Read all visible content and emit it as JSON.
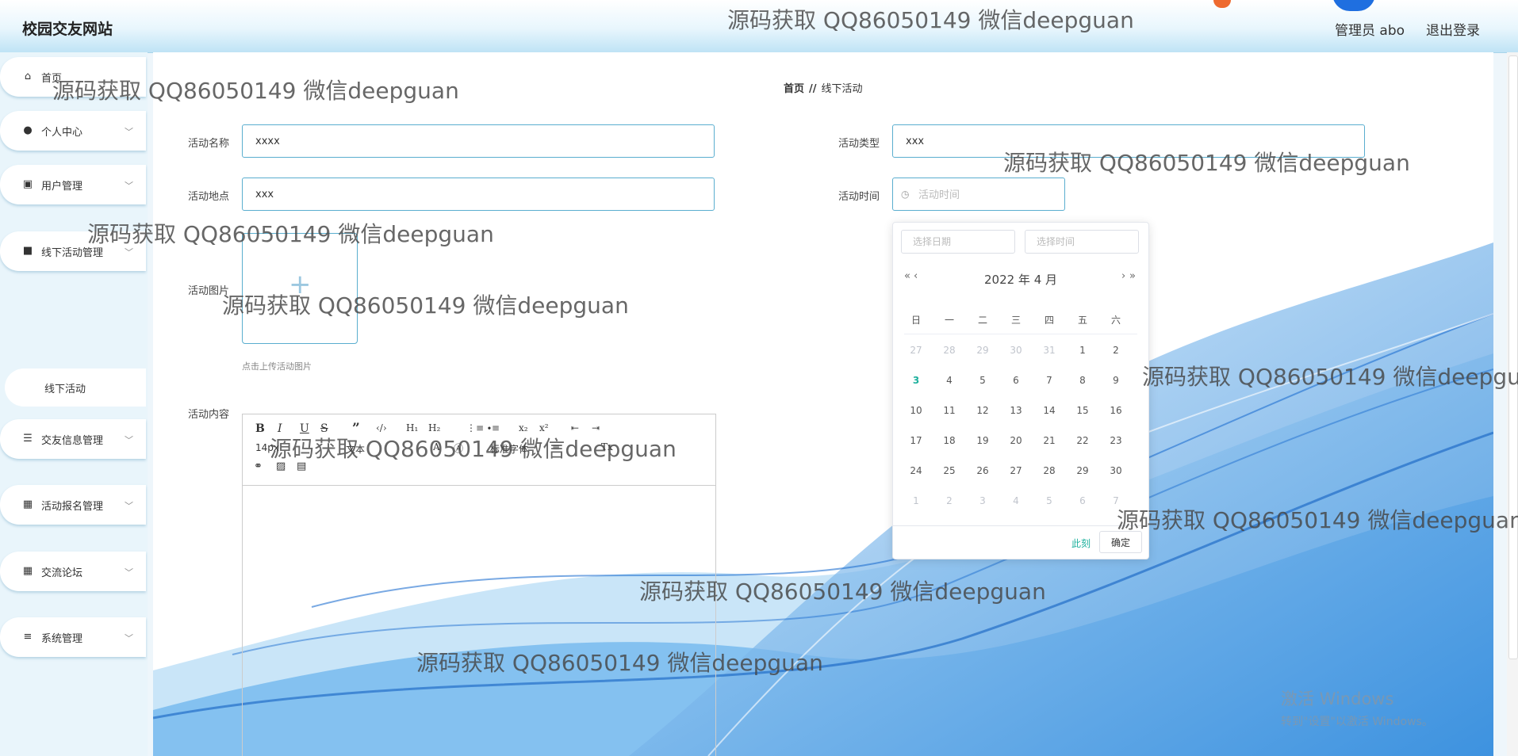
{
  "header": {
    "site_title": "校园交友网站",
    "user_info": "管理员 abo",
    "logout": "退出登录"
  },
  "sidebar": {
    "items": [
      {
        "label": "首页",
        "icon": "home-icon"
      },
      {
        "label": "个人中心",
        "icon": "user-icon"
      },
      {
        "label": "用户管理",
        "icon": "clipboard-icon"
      },
      {
        "label": "线下活动管理",
        "icon": "briefcase-icon"
      },
      {
        "label": "交友信息管理",
        "icon": "list-icon"
      },
      {
        "label": "活动报名管理",
        "icon": "grid-icon"
      },
      {
        "label": "交流论坛",
        "icon": "grid-icon"
      },
      {
        "label": "系统管理",
        "icon": "sliders-icon"
      }
    ],
    "sub_item": "线下活动"
  },
  "breadcrumb": {
    "home": "首页",
    "separator": "//",
    "current": "线下活动"
  },
  "form": {
    "name_label": "活动名称",
    "name_value": "xxxx",
    "type_label": "活动类型",
    "type_value": "xxx",
    "location_label": "活动地点",
    "location_value": "xxx",
    "time_label": "活动时间",
    "time_placeholder": "活动时间",
    "image_label": "活动图片",
    "image_hint": "点击上传活动图片",
    "content_label": "活动内容"
  },
  "editor": {
    "size_value": "14px",
    "text_value": "文本",
    "font_value": "标准字体"
  },
  "date_picker": {
    "date_placeholder": "选择日期",
    "time_placeholder": "选择时间",
    "prev_year": "«",
    "prev_month": "‹",
    "next_month": "›",
    "next_year": "»",
    "title": "2022 年  4 月",
    "weekdays": [
      "日",
      "一",
      "二",
      "三",
      "四",
      "五",
      "六"
    ],
    "weeks": [
      [
        {
          "d": "27",
          "o": true
        },
        {
          "d": "28",
          "o": true
        },
        {
          "d": "29",
          "o": true
        },
        {
          "d": "30",
          "o": true
        },
        {
          "d": "31",
          "o": true
        },
        {
          "d": "1"
        },
        {
          "d": "2"
        }
      ],
      [
        {
          "d": "3",
          "today": true
        },
        {
          "d": "4"
        },
        {
          "d": "5"
        },
        {
          "d": "6"
        },
        {
          "d": "7"
        },
        {
          "d": "8"
        },
        {
          "d": "9"
        }
      ],
      [
        {
          "d": "10"
        },
        {
          "d": "11"
        },
        {
          "d": "12"
        },
        {
          "d": "13"
        },
        {
          "d": "14"
        },
        {
          "d": "15"
        },
        {
          "d": "16"
        }
      ],
      [
        {
          "d": "17"
        },
        {
          "d": "18"
        },
        {
          "d": "19"
        },
        {
          "d": "20"
        },
        {
          "d": "21"
        },
        {
          "d": "22"
        },
        {
          "d": "23"
        }
      ],
      [
        {
          "d": "24"
        },
        {
          "d": "25"
        },
        {
          "d": "26"
        },
        {
          "d": "27"
        },
        {
          "d": "28"
        },
        {
          "d": "29"
        },
        {
          "d": "30"
        }
      ],
      [
        {
          "d": "1",
          "o": true
        },
        {
          "d": "2",
          "o": true
        },
        {
          "d": "3",
          "o": true
        },
        {
          "d": "4",
          "o": true
        },
        {
          "d": "5",
          "o": true
        },
        {
          "d": "6",
          "o": true
        },
        {
          "d": "7",
          "o": true
        }
      ]
    ],
    "now": "此刻",
    "confirm": "确定"
  },
  "watermark": "源码获取 QQ86050149 微信deepguan",
  "os_notice": {
    "title": "激活 Windows",
    "subtitle": "转到\"设置\"以激活 Windows。"
  },
  "colors": {
    "accent": "#1fb19e",
    "border": "#5aaecf",
    "wave": "#2b8be0"
  }
}
